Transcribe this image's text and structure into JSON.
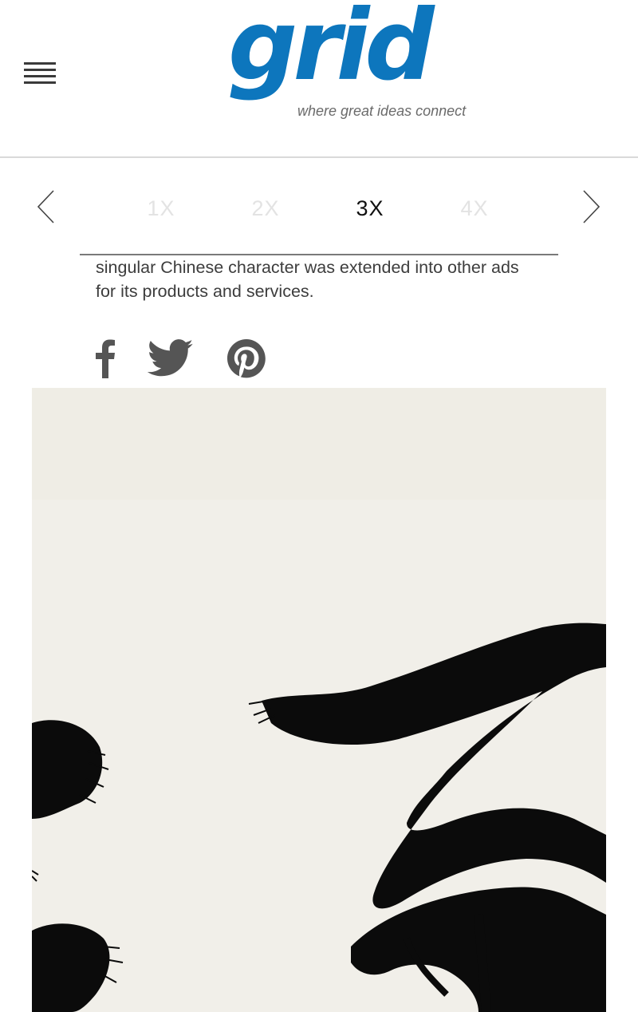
{
  "header": {
    "menu_icon": "hamburger-menu-icon",
    "logo": {
      "word": "grid",
      "tagline": "where great ideas connect",
      "color": "#0d76bd"
    }
  },
  "zoom": {
    "prev_icon": "chevron-left-icon",
    "next_icon": "chevron-right-icon",
    "options": [
      "1X",
      "2X",
      "3X",
      "4X"
    ],
    "selected": "3X"
  },
  "article": {
    "caption": "singular Chinese character was extended into other ads for its products and services."
  },
  "share": {
    "icons": [
      "facebook-icon",
      "twitter-icon",
      "pinterest-icon"
    ],
    "color": "#555555"
  },
  "image": {
    "description_icon": "chinese-calligraphy-image"
  }
}
